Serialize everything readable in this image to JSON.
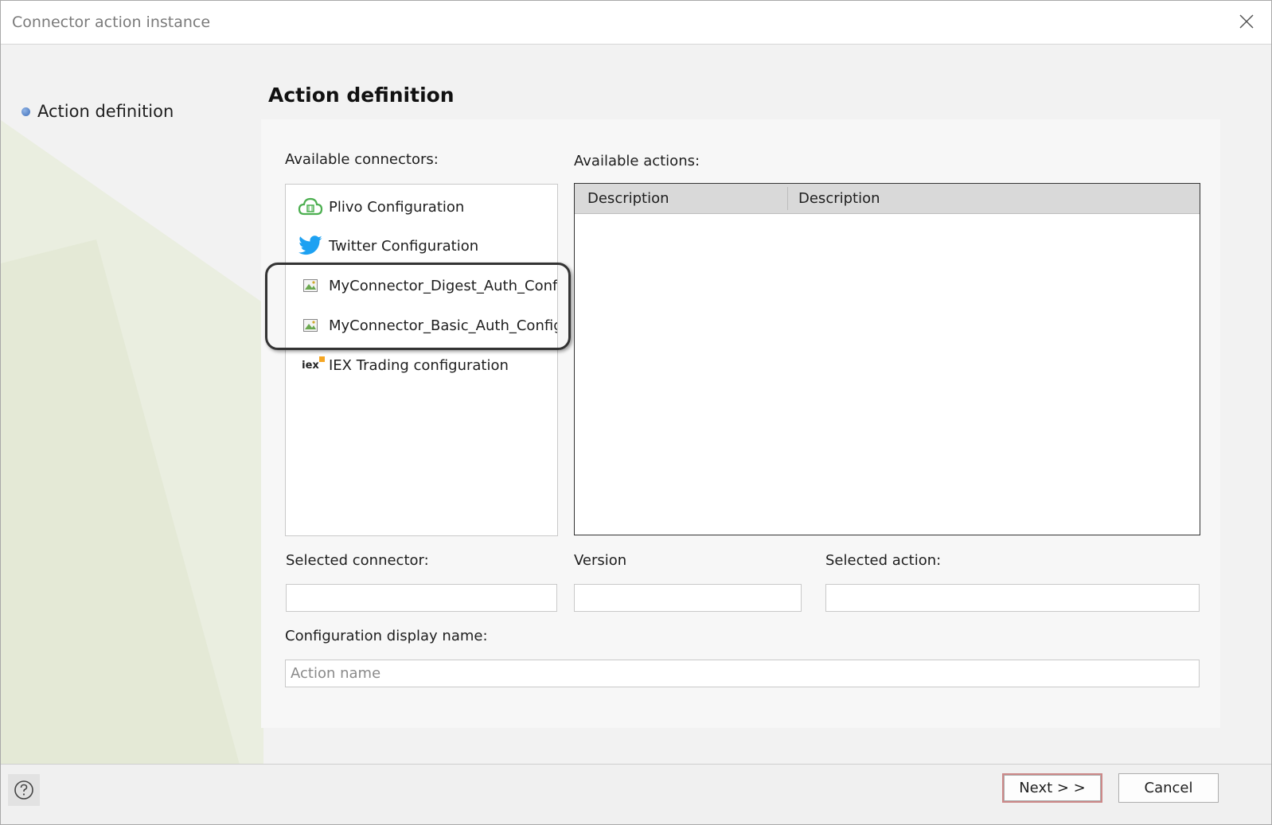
{
  "window": {
    "title": "Connector action instance"
  },
  "steps": [
    {
      "label": "Action definition"
    }
  ],
  "page": {
    "heading": "Action definition"
  },
  "connectors": {
    "label": "Available connectors:",
    "items": [
      {
        "label": "Plivo Configuration",
        "icon": "plivo-cloud-icon"
      },
      {
        "label": "Twitter Configuration",
        "icon": "twitter-bird-icon"
      },
      {
        "label": "MyConnector_Digest_Auth_Config",
        "icon": "image-icon"
      },
      {
        "label": "MyConnector_Basic_Auth_Configu",
        "icon": "image-icon"
      },
      {
        "label": "IEX Trading configuration",
        "icon": "iex-logo-icon",
        "icon_text": "iex"
      }
    ]
  },
  "actions": {
    "label": "Available actions:",
    "columns": [
      "Description",
      "Description"
    ]
  },
  "form": {
    "selected_connector_label": "Selected connector:",
    "version_label": "Version",
    "selected_action_label": "Selected action:",
    "display_name_label": "Configuration display name:",
    "display_name_placeholder": "Action name"
  },
  "footer": {
    "next_label": "Next > >",
    "cancel_label": "Cancel"
  },
  "colors": {
    "twitter": "#1da1f2",
    "plivo": "#4caf50",
    "highlight_border": "#333333"
  }
}
